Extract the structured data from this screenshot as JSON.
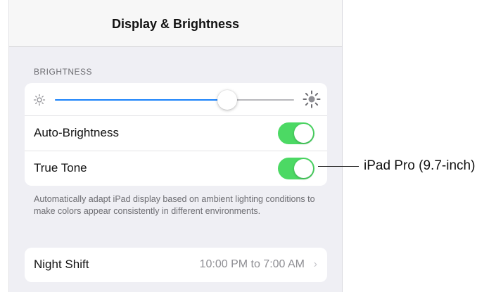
{
  "nav": {
    "title": "Display & Brightness"
  },
  "brightness": {
    "section_header": "BRIGHTNESS",
    "slider_level": 0.72,
    "min_icon": "sun-small-icon",
    "max_icon": "sun-large-icon"
  },
  "auto_brightness": {
    "label": "Auto-Brightness",
    "on": true
  },
  "true_tone": {
    "label": "True Tone",
    "on": true
  },
  "footer_note": "Automatically adapt iPad display based on ambient lighting conditions to make colors appear consistently in different environments.",
  "night_shift": {
    "label": "Night Shift",
    "value": "10:00 PM to 7:00 AM",
    "chevron_icon": "chevron-right-icon"
  },
  "callout": {
    "label": "iPad Pro (9.7-inch)"
  },
  "colors": {
    "toggle_on": "#4cd964",
    "slider_fill": "#1a82fb",
    "background": "#efeff4"
  }
}
